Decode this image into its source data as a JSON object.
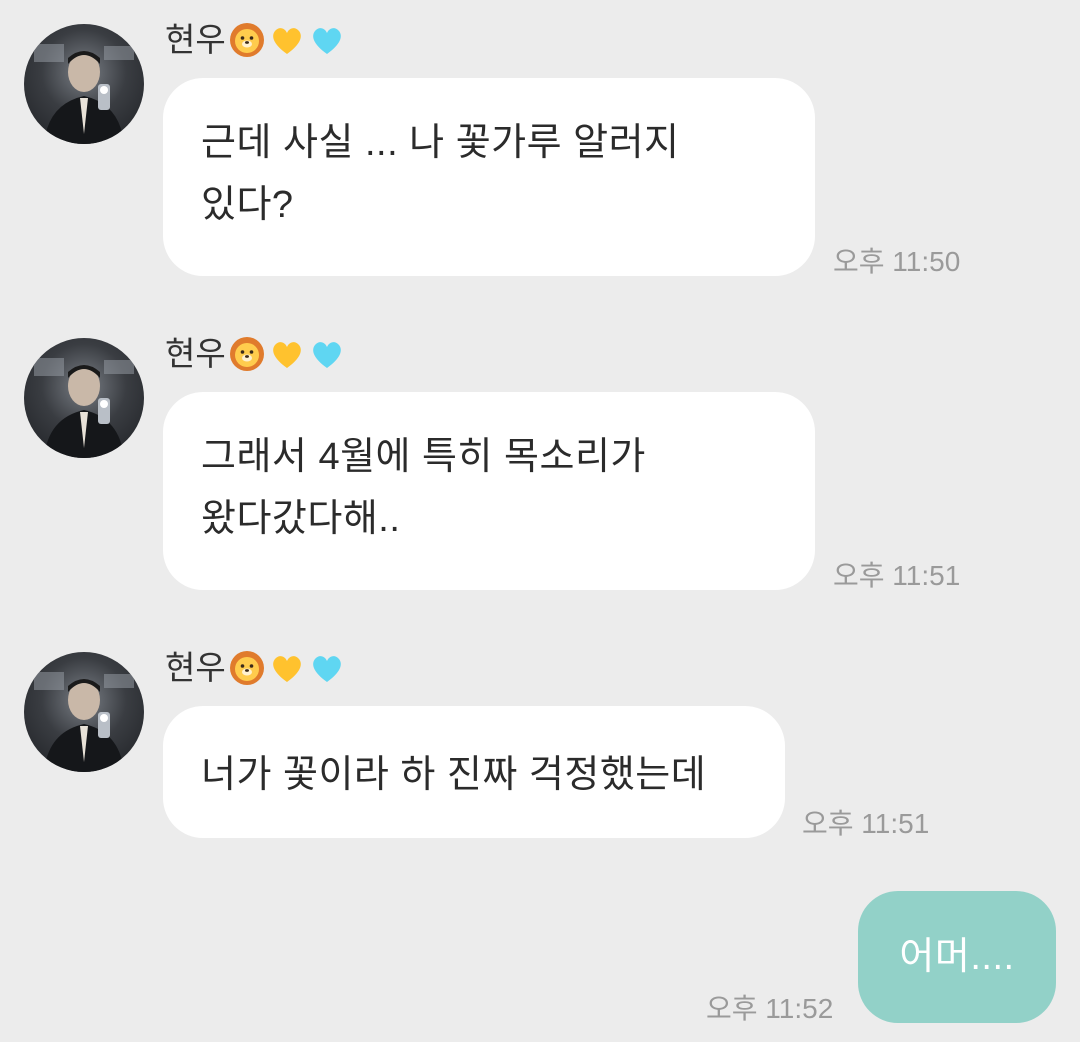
{
  "sender": {
    "name": "현우",
    "emojis": [
      "lion-face-icon",
      "yellow-heart-icon",
      "light-blue-heart-icon"
    ]
  },
  "messages": [
    {
      "from": "other",
      "lines": [
        "근데 사실 ... 나 꽃가루 알러지",
        "있다?"
      ],
      "time": "오후 11:50"
    },
    {
      "from": "other",
      "lines": [
        "그래서 4월에 특히 목소리가",
        "왔다갔다해.."
      ],
      "time": "오후 11:51"
    },
    {
      "from": "other",
      "lines": [
        "너가 꽃이라 하 진짜 걱정했는데"
      ],
      "time": "오후 11:51"
    },
    {
      "from": "me",
      "lines": [
        "어머...."
      ],
      "time": "오후 11:52"
    }
  ],
  "colors": {
    "background": "#ececec",
    "bubble_other": "#ffffff",
    "bubble_mine": "#92d1c8",
    "timestamp": "#9a9a9a"
  }
}
